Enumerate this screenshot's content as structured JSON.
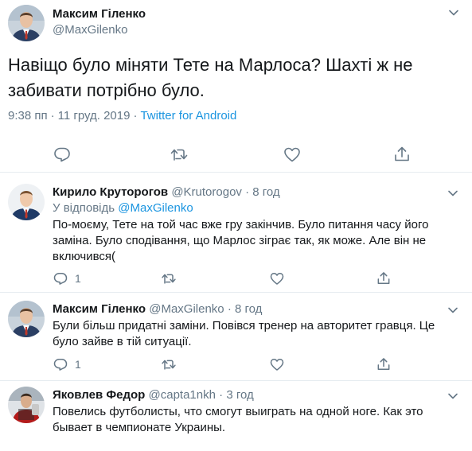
{
  "main_tweet": {
    "author_name": "Максим Гіленко",
    "author_handle": "@MaxGilenko",
    "text": "Навіщо було міняти Тете на Марлоса? Шахті ж не забивати потрібно було.",
    "time": "9:38 пп",
    "separator": "·",
    "date": "11 груд. 2019",
    "source": "Twitter for Android",
    "actions": [
      "reply-icon",
      "retweet-icon",
      "like-icon",
      "share-icon"
    ]
  },
  "replies": [
    {
      "author_name": "Кирило Круторогов",
      "author_handle": "@Krutorogov",
      "dot": "·",
      "time": "8 год",
      "reply_to_prefix": "У відповідь",
      "reply_to_handle": "@MaxGilenko",
      "text": "По-моєму, Тете на той час вже гру закінчив. Було питання часу його заміна. Було сподівання, що Марлос зіграє так, як може. Але він не включився(",
      "reply_count": "1"
    },
    {
      "author_name": "Максим Гіленко",
      "author_handle": "@MaxGilenko",
      "dot": "·",
      "time": "8 год",
      "text": "Були більш придатні заміни. Повівся тренер на авторитет гравця. Це було зайве в тій ситуації.",
      "reply_count": "1"
    },
    {
      "author_name": "Яковлев Федор",
      "author_handle": "@capta1nkh",
      "dot": "·",
      "time": "3 год",
      "text": "Повелись футболисты, что смогут выиграть на одной ноге. Как это бывает в чемпионате Украины."
    }
  ],
  "colors": {
    "text": "#14171a",
    "secondary": "#657786",
    "link": "#1b95e0",
    "border": "#e6ecf0"
  }
}
